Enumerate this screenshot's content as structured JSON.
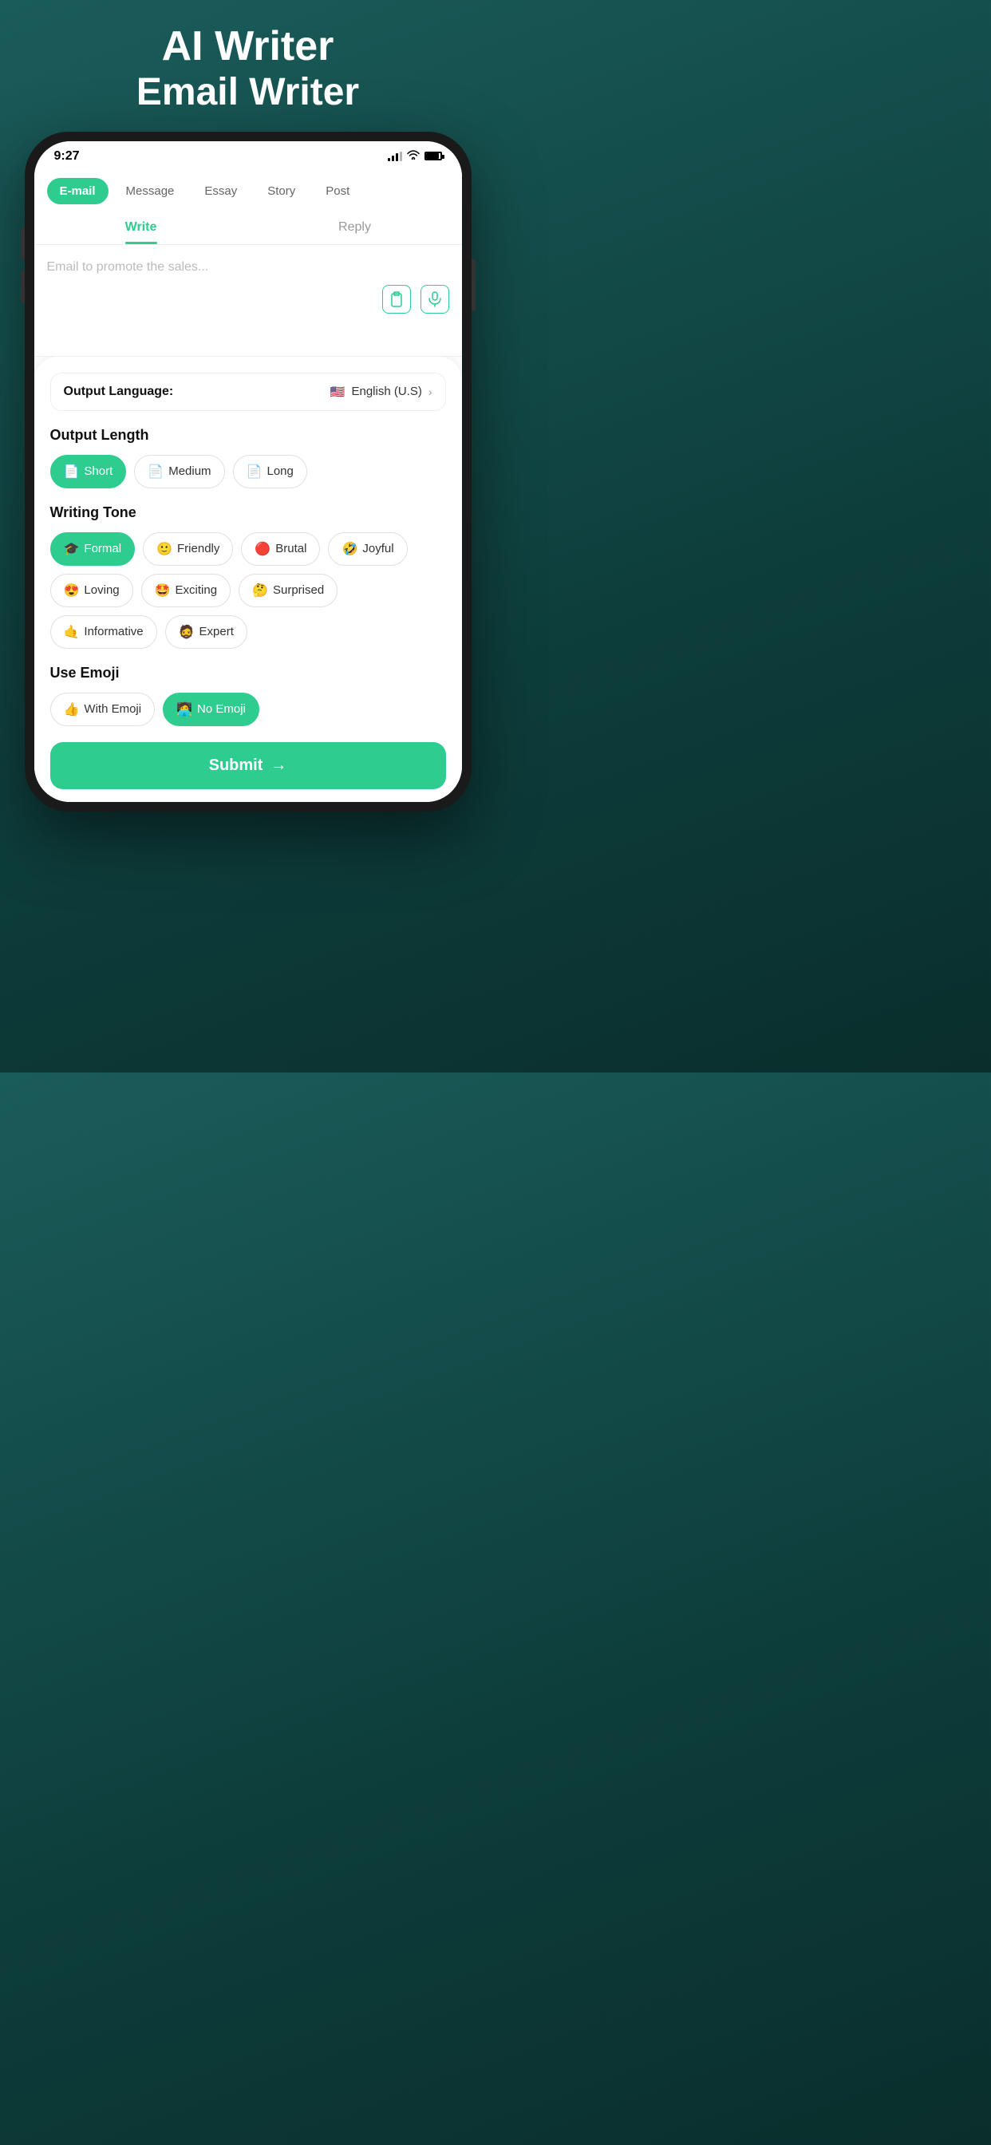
{
  "header": {
    "line1": "AI Writer",
    "line2": "Email Writer"
  },
  "status_bar": {
    "time": "9:27"
  },
  "tabs": {
    "items": [
      "E-mail",
      "Message",
      "Essay",
      "Story",
      "Post"
    ],
    "active": "E-mail"
  },
  "write_reply": {
    "tabs": [
      "Write",
      "Reply"
    ],
    "active": "Write"
  },
  "text_area": {
    "placeholder": "Email to promote the sales..."
  },
  "output_language": {
    "label": "Output Language:",
    "value": "English (U.S)"
  },
  "output_length": {
    "title": "Output Length",
    "options": [
      {
        "emoji": "📄",
        "label": "Short",
        "active": true
      },
      {
        "emoji": "📄",
        "label": "Medium",
        "active": false
      },
      {
        "emoji": "📄",
        "label": "Long",
        "active": false
      }
    ]
  },
  "writing_tone": {
    "title": "Writing Tone",
    "options": [
      {
        "emoji": "🎓",
        "label": "Formal",
        "active": true
      },
      {
        "emoji": "🙂",
        "label": "Friendly",
        "active": false
      },
      {
        "emoji": "🔴",
        "label": "Brutal",
        "active": false
      },
      {
        "emoji": "🤣",
        "label": "Joyful",
        "active": false
      },
      {
        "emoji": "😍",
        "label": "Loving",
        "active": false
      },
      {
        "emoji": "🤩",
        "label": "Exciting",
        "active": false
      },
      {
        "emoji": "🤔",
        "label": "Surprised",
        "active": false
      },
      {
        "emoji": "🤙",
        "label": "Informative",
        "active": false
      },
      {
        "emoji": "🧔",
        "label": "Expert",
        "active": false
      }
    ]
  },
  "use_emoji": {
    "title": "Use Emoji",
    "options": [
      {
        "emoji": "👍",
        "label": "With Emoji",
        "active": false
      },
      {
        "emoji": "🧑‍💻",
        "label": "No Emoji",
        "active": true
      }
    ]
  },
  "submit": {
    "label": "Submit",
    "arrow": "→"
  }
}
